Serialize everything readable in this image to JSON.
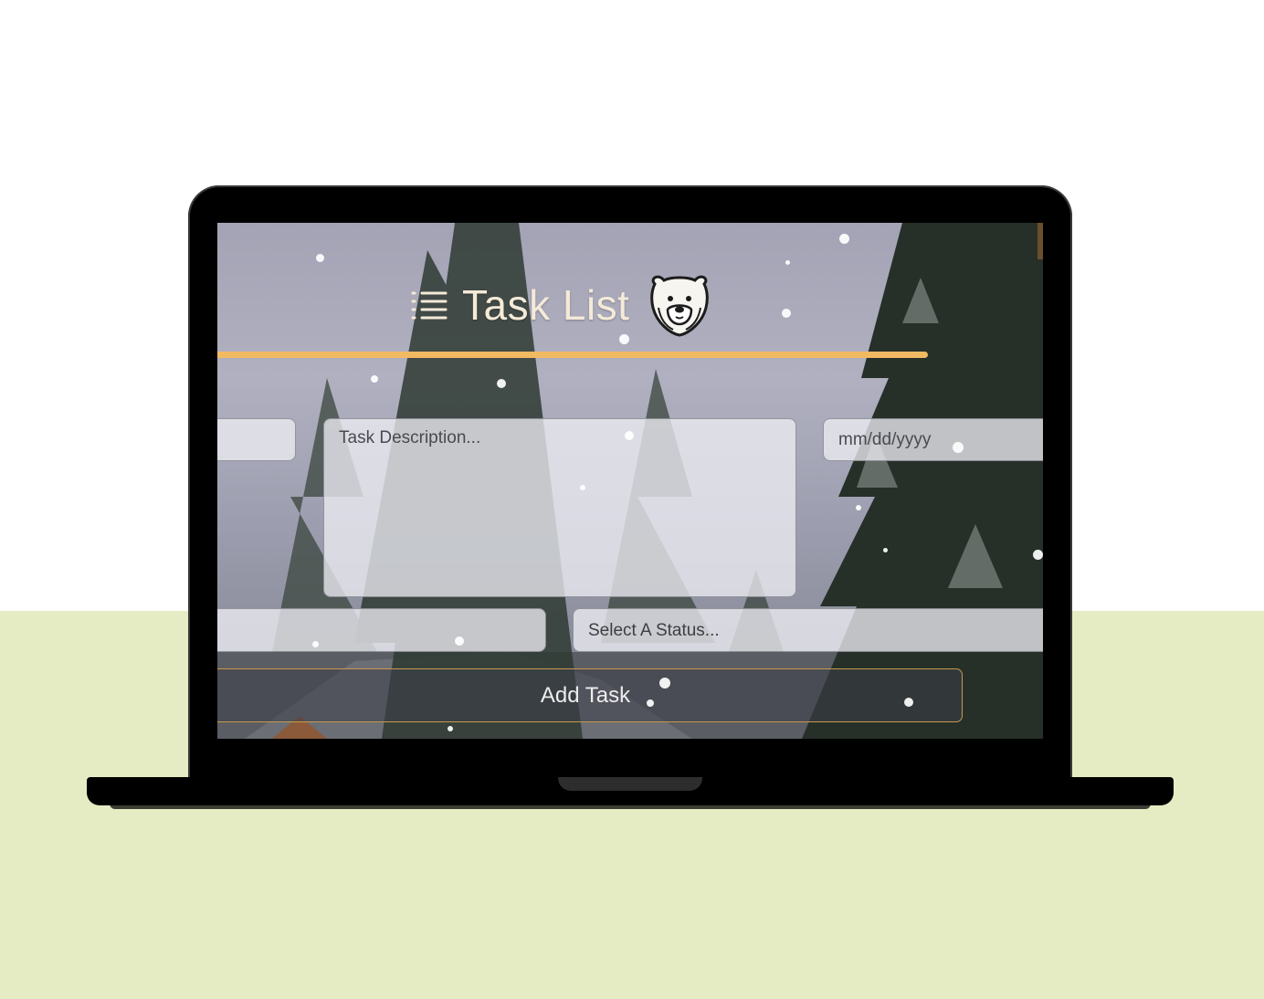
{
  "app": {
    "title": "Task List"
  },
  "form": {
    "title_placeholder": "",
    "description_placeholder": "Task Description...",
    "date_placeholder": "mm/dd/yyyy",
    "assignee_placeholder": "",
    "status_placeholder": "Select A Status...",
    "add_button_label": "Add Task"
  },
  "icons": {
    "title_left": "list-icon",
    "title_right": "polar-bear-icon"
  },
  "colors": {
    "accent": "#f2b963",
    "title_text": "#f4ead8",
    "floor": "#e5ecc3",
    "button_border": "#c79a4c"
  }
}
